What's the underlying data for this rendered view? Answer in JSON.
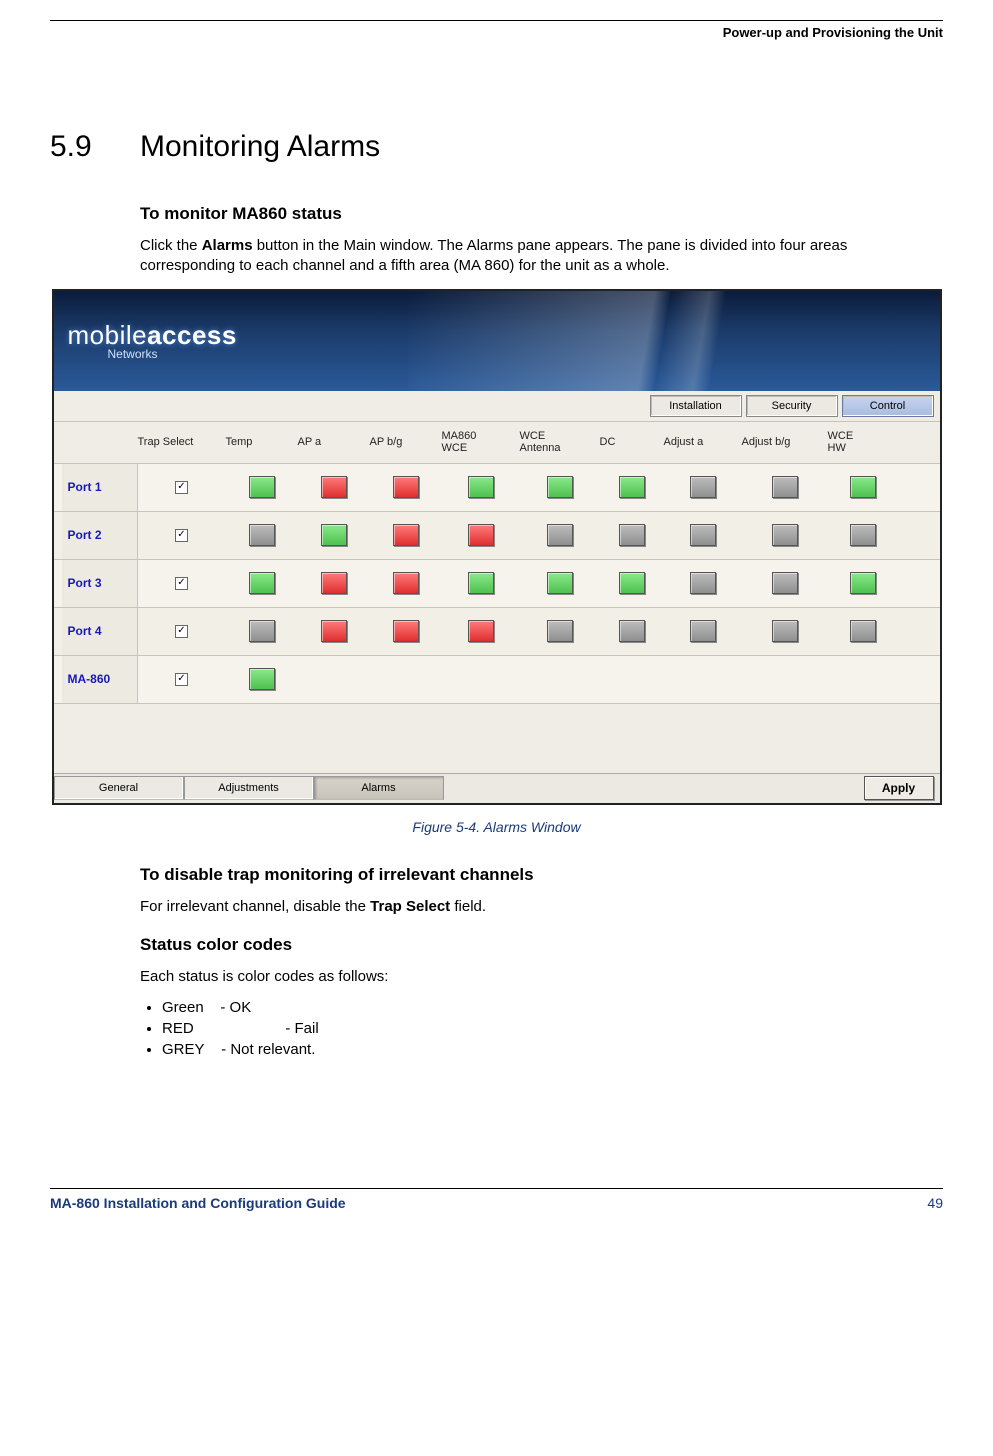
{
  "running_head": "Power-up and Provisioning the Unit",
  "section_number": "5.9",
  "section_title": "Monitoring Alarms",
  "sub1": "To monitor MA860 status",
  "para1_a": "Click the ",
  "para1_bold": "Alarms",
  "para1_b": " button in the Main window. The Alarms pane appears. The pane is divided into four areas corresponding to each channel and a fifth area (MA 860) for the unit as a whole.",
  "figure_caption": "Figure 5-4. Alarms Window",
  "sub2": "To disable trap monitoring of irrelevant channels",
  "para2_a": "For irrelevant channel, disable the ",
  "para2_bold": "Trap Select",
  "para2_b": " field.",
  "sub3": "Status color codes",
  "para3": "Each status is color codes as follows:",
  "codes": {
    "green": "Green    - OK",
    "red": "RED                      - Fail",
    "grey": "GREY    - Not relevant."
  },
  "footer_title": "MA-860 Installation and Configuration Guide",
  "footer_page": "49",
  "app": {
    "logo_a": "mobile",
    "logo_b": "access",
    "logo_sub": "Networks",
    "top_tabs": {
      "installation": "Installation",
      "security": "Security",
      "control": "Control"
    },
    "columns": {
      "trap": "Trap Select",
      "temp": "Temp",
      "apa": "AP a",
      "apbg": "AP b/g",
      "wce": "MA860\nWCE",
      "ant": "WCE\nAntenna",
      "dc": "DC",
      "adja": "Adjust a",
      "adjbg": "Adjust b/g",
      "hw": "WCE\nHW"
    },
    "rows": [
      {
        "label": "Port 1",
        "trap": true,
        "leds": [
          "green",
          "red",
          "red",
          "green",
          "green",
          "green",
          "grey",
          "grey",
          "green"
        ]
      },
      {
        "label": "Port 2",
        "trap": true,
        "leds": [
          "grey",
          "green",
          "red",
          "red",
          "grey",
          "grey",
          "grey",
          "grey",
          "grey"
        ]
      },
      {
        "label": "Port 3",
        "trap": true,
        "leds": [
          "green",
          "red",
          "red",
          "green",
          "green",
          "green",
          "grey",
          "grey",
          "green"
        ]
      },
      {
        "label": "Port 4",
        "trap": true,
        "leds": [
          "grey",
          "red",
          "red",
          "red",
          "grey",
          "grey",
          "grey",
          "grey",
          "grey"
        ]
      },
      {
        "label": "MA-860",
        "trap": true,
        "leds": [
          "green"
        ]
      }
    ],
    "bottom_tabs": {
      "general": "General",
      "adjustments": "Adjustments",
      "alarms": "Alarms"
    },
    "apply": "Apply"
  }
}
